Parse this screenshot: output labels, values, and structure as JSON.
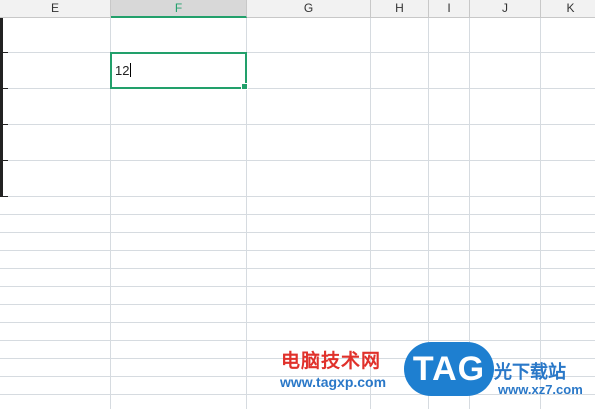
{
  "columns": [
    "E",
    "F",
    "G",
    "H",
    "I",
    "J",
    "K"
  ],
  "active_column": "F",
  "cell": {
    "value": "12"
  },
  "watermark": {
    "cn_text": "电脑技术网",
    "url": "www.tagxp.com",
    "tag": "TAG",
    "cn_text2": "光下载站",
    "url2": "www.xz7.com"
  },
  "colors": {
    "accent": "#22a06b",
    "watermark_red": "#e0312b",
    "watermark_blue": "#1e7fd0"
  }
}
